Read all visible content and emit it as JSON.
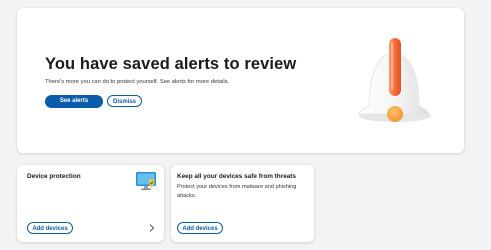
{
  "hero": {
    "title": "You have saved alerts to review",
    "description": "There's more you can do to protect yourself. See alerts for more details.",
    "see_alerts_label": "See alerts",
    "dismiss_label": "Dismiss",
    "illustration_icon": "bell-alert-icon"
  },
  "cards": {
    "device": {
      "title": "Device protection",
      "button_label": "Add devices",
      "icon": "device-shield-icon",
      "chevron_icon": "chevron-right-icon"
    },
    "keep_safe": {
      "title": "Keep all your devices safe from threats",
      "description": "Protect your devices from malware and phishing attacks.",
      "button_label": "Add devices"
    }
  },
  "colors": {
    "accent": "#0b5cab",
    "alert_orange": "#f06a3c",
    "background": "#f3f3f5"
  }
}
